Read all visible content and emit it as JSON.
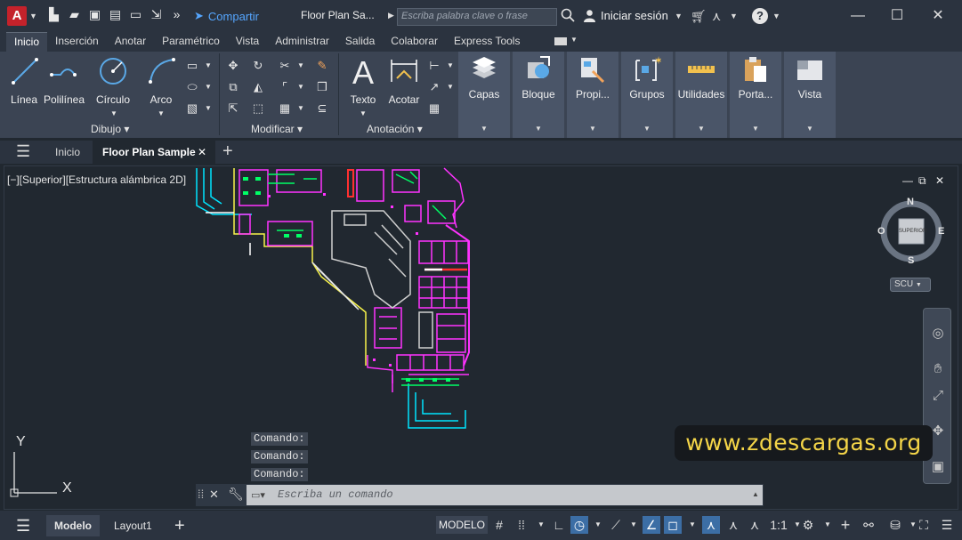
{
  "titlebar": {
    "logo_letter": "A",
    "share_label": "Compartir",
    "document_title": "Floor Plan Sa...",
    "search_placeholder": "Escriba palabra clave o frase",
    "signin_label": "Iniciar sesión",
    "help_label": "?"
  },
  "ribbon": {
    "tabs": [
      "Inicio",
      "Inserción",
      "Anotar",
      "Paramétrico",
      "Vista",
      "Administrar",
      "Salida",
      "Colaborar",
      "Express Tools"
    ],
    "active_tab": "Inicio",
    "draw_tools": [
      "Línea",
      "Polilínea",
      "Círculo",
      "Arco"
    ],
    "panels": {
      "draw": "Dibujo",
      "modify": "Modificar",
      "annotation": "Anotación"
    },
    "annotation_tools": [
      "Texto",
      "Acotar"
    ],
    "large_panels": [
      "Capas",
      "Bloque",
      "Propi...",
      "Grupos",
      "Utilidades",
      "Porta...",
      "Vista"
    ]
  },
  "filetabs": {
    "home": "Inicio",
    "active_file": "Floor Plan Sample"
  },
  "viewport": {
    "label": "[−][Superior][Estructura alámbrica 2D]",
    "viewcube_face": "SUPERIOR",
    "compass": {
      "n": "N",
      "s": "S",
      "e": "E",
      "w": "O"
    },
    "ucs_menu": "SCU",
    "ucs_y": "Y",
    "ucs_x": "X"
  },
  "watermark": "www.zdescargas.org",
  "command": {
    "history": [
      "Comando:",
      "Comando:",
      "Comando:"
    ],
    "placeholder": "Escriba un comando"
  },
  "statusbar": {
    "layout_tabs": [
      "Modelo",
      "Layout1"
    ],
    "model_label": "MODELO",
    "scale": "1:1"
  },
  "colors": {
    "accent": "#3c6ea5",
    "brand": "#c4222b",
    "watermark_text": "#f4d548"
  }
}
